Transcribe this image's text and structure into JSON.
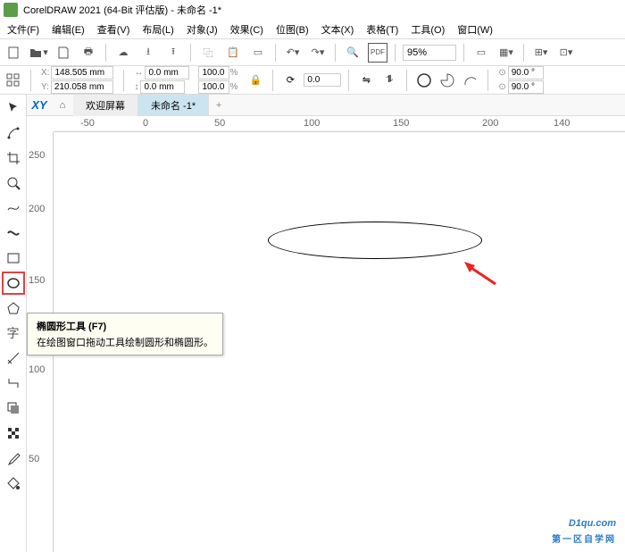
{
  "title": "CorelDRAW 2021 (64-Bit 评估版) - 未命名 -1*",
  "menu": {
    "file": "文件(F)",
    "edit": "编辑(E)",
    "view": "查看(V)",
    "layout": "布局(L)",
    "object": "对象(J)",
    "effects": "效果(C)",
    "bitmap": "位图(B)",
    "text": "文本(X)",
    "table": "表格(T)",
    "tools": "工具(O)",
    "window": "窗口(W)"
  },
  "zoom": "95%",
  "coords": {
    "x": "148.505 mm",
    "y": "210.058 mm"
  },
  "size": {
    "w": "0.0 mm",
    "h": "0.0 mm"
  },
  "scale": {
    "w": "100.0",
    "h": "100.0"
  },
  "angle": "0.0",
  "rot": {
    "a": "90.0 °",
    "b": "90.0 °"
  },
  "tabs": {
    "xy": "XY",
    "welcome": "欢迎屏幕",
    "doc": "未命名 -1*",
    "add": "+"
  },
  "ruler_h": [
    "-50",
    "0",
    "50",
    "100",
    "150"
  ],
  "ruler_v": [
    "250",
    "200",
    "150",
    "100",
    "50"
  ],
  "tooltip": {
    "title": "椭圆形工具 (F7)",
    "body": "在绘图窗口拖动工具绘制圆形和椭圆形。"
  },
  "watermark": {
    "main": "D1qu.com",
    "sub": "第一区自学网"
  }
}
